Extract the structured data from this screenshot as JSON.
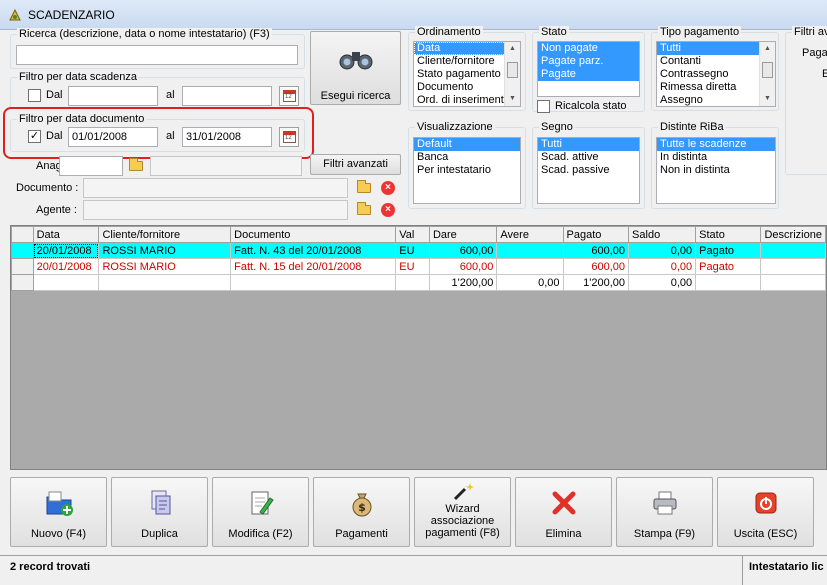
{
  "window": {
    "title": "SCADENZARIO"
  },
  "ricerca": {
    "label": "Ricerca (descrizione, data o nome intestatario) (F3)",
    "value": ""
  },
  "esegui_ricerca": {
    "label": "Esegui ricerca"
  },
  "filtro_scadenza": {
    "label": "Filtro per data scadenza",
    "dal_label": "Dal",
    "al_label": "al",
    "dal_value": "",
    "al_value": "",
    "checked": false
  },
  "filtro_documento": {
    "label": "Filtro per data documento",
    "dal_label": "Dal",
    "al_label": "al",
    "dal_value": "01/01/2008",
    "al_value": "31/01/2008",
    "checked": true
  },
  "anag": {
    "label": "Anag. :",
    "value": ""
  },
  "filtri_avanzati": {
    "label": "Filtri avanzati"
  },
  "documento": {
    "label": "Documento :",
    "value": ""
  },
  "agente": {
    "label": "Agente :",
    "value": ""
  },
  "ordinamento": {
    "label": "Ordinamento",
    "items": [
      "Data",
      "Cliente/fornitore",
      "Stato pagamento",
      "Documento",
      "Ord. di inserimento"
    ]
  },
  "stato": {
    "label": "Stato",
    "items": [
      "Non pagate",
      "Pagate parz.",
      "Pagate"
    ],
    "ricalcola_label": "Ricalcola stato"
  },
  "tipo_pagamento": {
    "label": "Tipo pagamento",
    "items": [
      "Tutti",
      "Contanti",
      "Contrassegno",
      "Rimessa diretta",
      "Assegno"
    ]
  },
  "filtri_av": {
    "label": "Filtri av",
    "line1": "Pagan",
    "line2": "E"
  },
  "visualizzazione": {
    "label": "Visualizzazione",
    "items": [
      "Default",
      "Banca",
      "Per intestatario"
    ]
  },
  "segno": {
    "label": "Segno",
    "items": [
      "Tutti",
      "Scad. attive",
      "Scad. passive"
    ]
  },
  "distinte": {
    "label": "Distinte RiBa",
    "items": [
      "Tutte le scadenze",
      "In distinta",
      "Non in distinta"
    ]
  },
  "grid": {
    "columns": [
      "Data",
      "Cliente/fornitore",
      "Documento",
      "Val",
      "Dare",
      "Avere",
      "Pagato",
      "Saldo",
      "Stato",
      "Descrizione"
    ],
    "rows": [
      [
        "20/01/2008",
        "ROSSI MARIO",
        "Fatt. N. 43 del 20/01/2008",
        "EU",
        "600,00",
        "",
        "600,00",
        "0,00",
        "Pagato",
        ""
      ],
      [
        "20/01/2008",
        "ROSSI MARIO",
        "Fatt. N. 15 del 20/01/2008",
        "EU",
        "600,00",
        "",
        "600,00",
        "0,00",
        "Pagato",
        ""
      ],
      [
        "",
        "",
        "",
        "",
        "1'200,00",
        "0,00",
        "1'200,00",
        "0,00",
        "",
        ""
      ]
    ]
  },
  "toolbar": {
    "nuovo": "Nuovo (F4)",
    "duplica": "Duplica",
    "modifica": "Modifica (F2)",
    "pagamenti": "Pagamenti",
    "wizard_1": "Wizard",
    "wizard_2": "associazione",
    "wizard_3": "pagamenti (F8)",
    "elimina": "Elimina",
    "stampa": "Stampa (F9)",
    "uscita": "Uscita (ESC)"
  },
  "status": {
    "left": "2 record trovati",
    "right": "Intestatario lic"
  },
  "colors": {
    "selection": "#3399ff",
    "current_row": "#00ffff",
    "red_text": "#d00000",
    "highlight": "#e02020"
  }
}
